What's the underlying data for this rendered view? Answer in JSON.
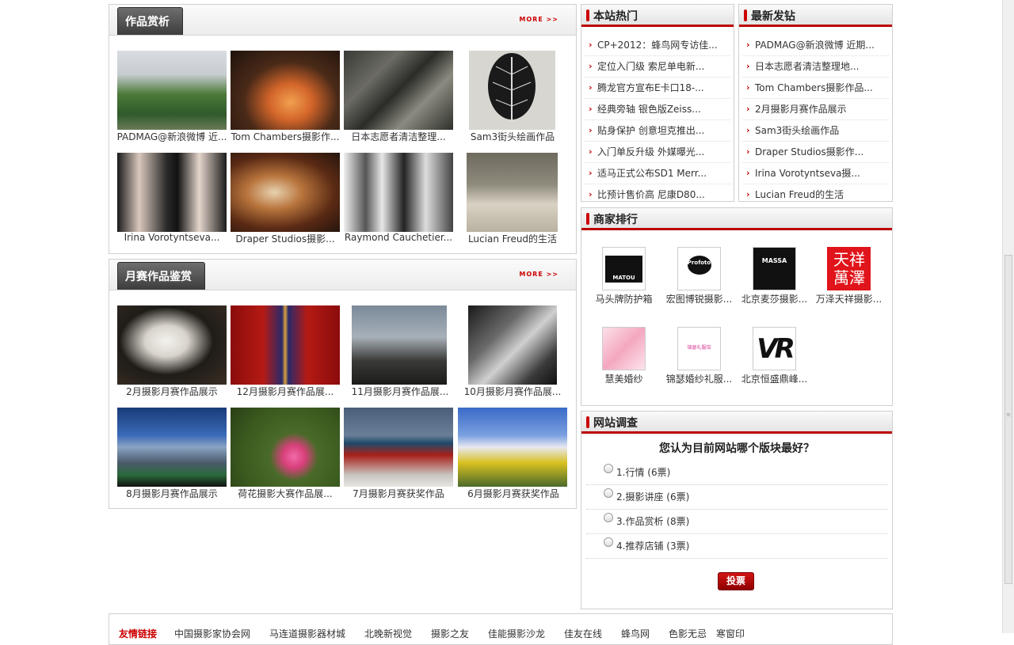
{
  "works": {
    "title": "作品赏析",
    "more": "MORE >>",
    "items": [
      {
        "caption": "PADMAG@新浪微博 近..."
      },
      {
        "caption": "Tom Chambers摄影作..."
      },
      {
        "caption": "日本志愿者清洁整理..."
      },
      {
        "caption": "Sam3街头绘画作品"
      },
      {
        "caption": "Irina Vorotyntseva..."
      },
      {
        "caption": "Draper Studios摄影..."
      },
      {
        "caption": "Raymond Cauchetier..."
      },
      {
        "caption": "Lucian Freud的生活"
      }
    ]
  },
  "monthly": {
    "title": "月赛作品鉴赏",
    "more": "MORE >>",
    "items": [
      {
        "caption": "2月摄影月赛作品展示"
      },
      {
        "caption": "12月摄影月赛作品展..."
      },
      {
        "caption": "11月摄影月赛作品展..."
      },
      {
        "caption": "10月摄影月赛作品展..."
      },
      {
        "caption": "8月摄影月赛作品展示"
      },
      {
        "caption": "荷花摄影大赛作品展..."
      },
      {
        "caption": "7月摄影月赛获奖作品"
      },
      {
        "caption": "6月摄影月赛获奖作品"
      }
    ]
  },
  "hot": {
    "title": "本站热门",
    "items": [
      "CP+2012：蜂鸟网专访佳...",
      "定位入门级 索尼单电新...",
      "腾龙官方宣布E卡口18-...",
      "经典旁轴 银色版Zeiss...",
      "贴身保护 创意坦克推出...",
      "入门单反升级 外媒曝光...",
      "适马正式公布SD1 Merr...",
      "比预计售价高 尼康D80..."
    ]
  },
  "latest": {
    "title": "最新发钻",
    "items": [
      "PADMAG@新浪微博 近期...",
      "日本志愿者清洁整理地...",
      "Tom Chambers摄影作品...",
      "2月摄影月赛作品展示",
      "Sam3街头绘画作品",
      "Draper Studios摄影作...",
      "Irina Vorotyntseva摄...",
      "Lucian Freud的生活"
    ]
  },
  "merchants": {
    "title": "商家排行",
    "items": [
      {
        "name": "马头牌防护箱",
        "logo_text": "MATOU"
      },
      {
        "name": "宏图博锐摄影...",
        "logo_text": "Profoto"
      },
      {
        "name": "北京麦莎摄影...",
        "logo_text": "MASSA"
      },
      {
        "name": "万泽天祥摄影...",
        "logo_text": "天祥萬澤"
      },
      {
        "name": "慧美婚纱",
        "logo_text": ""
      },
      {
        "name": "锦瑟婚纱礼服...",
        "logo_text": "锦瑟礼服馆"
      },
      {
        "name": "北京恒盛鼎峰...",
        "logo_text": "VR"
      }
    ]
  },
  "poll": {
    "title": "网站调查",
    "question": "您认为目前网站哪个版块最好？",
    "options": [
      "1.行情 (6票)",
      "2.摄影讲座 (6票)",
      "3.作品赏析 (8票)",
      "4.推荐店铺 (3票)"
    ],
    "vote_label": "投票"
  },
  "friend_links": {
    "title": "友情链接",
    "items": [
      "中国摄影家协会网",
      "马连道摄影器材城",
      "北晚新视觉",
      "摄影之友",
      "佳能摄影沙龙",
      "佳友在线",
      "蜂鸟网",
      "色影无忌",
      "寒窗印"
    ]
  }
}
